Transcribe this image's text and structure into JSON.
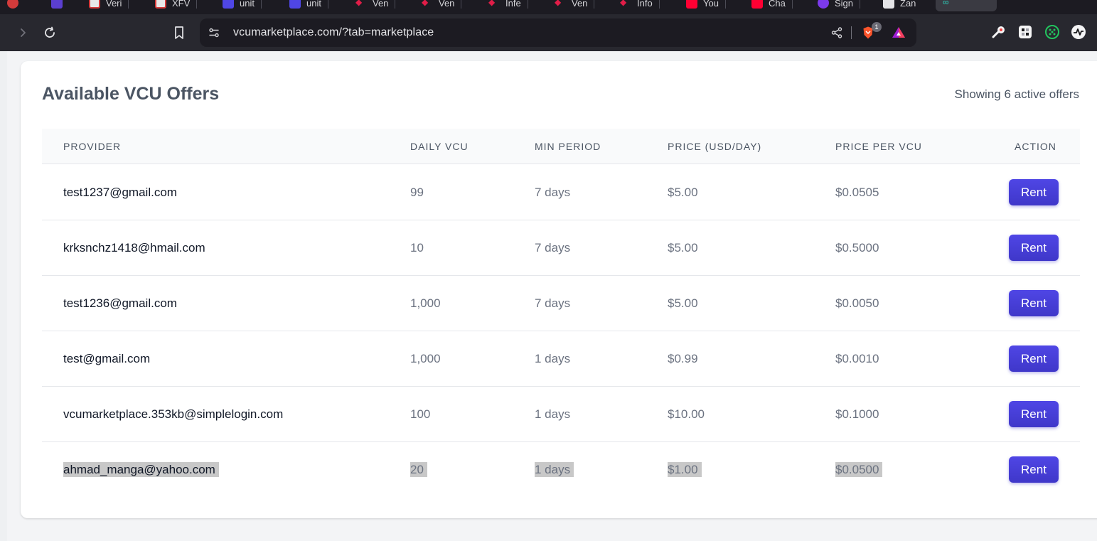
{
  "browser": {
    "tabs": [
      {
        "label": "Veri",
        "color": "#d63a3a"
      },
      {
        "label": "XFV",
        "color": "#d63a3a"
      },
      {
        "label": "unit",
        "color": "#4f46e5"
      },
      {
        "label": "unit",
        "color": "#4f46e5"
      },
      {
        "label": "Ven",
        "color": "#e11d48"
      },
      {
        "label": "Ven",
        "color": "#e11d48"
      },
      {
        "label": "Infe",
        "color": "#e11d48"
      },
      {
        "label": "Ven",
        "color": "#e11d48"
      },
      {
        "label": "Info",
        "color": "#e11d48"
      },
      {
        "label": "You",
        "color": "#ff0033"
      },
      {
        "label": "Cha",
        "color": "#ff0033"
      },
      {
        "label": "Sign",
        "color": "#7c3aed"
      },
      {
        "label": "Zan",
        "color": "#e4e4e7"
      }
    ],
    "url": "vcumarketplace.com/?tab=marketplace",
    "shield_badge_count": "1"
  },
  "page": {
    "title": "Available VCU Offers",
    "offer_count_text": "Showing 6 active offers"
  },
  "table": {
    "headers": {
      "provider": "PROVIDER",
      "daily_vcu": "DAILY VCU",
      "min_period": "MIN PERIOD",
      "price": "PRICE (USD/DAY)",
      "price_per_vcu": "PRICE PER VCU",
      "action": "ACTION"
    },
    "rows": [
      {
        "provider": "test1237@gmail.com",
        "daily_vcu": "99",
        "min_period": "7 days",
        "price": "$5.00",
        "price_per_vcu": "$0.0505",
        "action": "Rent"
      },
      {
        "provider": "krksnchz1418@hmail.com",
        "daily_vcu": "10",
        "min_period": "7 days",
        "price": "$5.00",
        "price_per_vcu": "$0.5000",
        "action": "Rent"
      },
      {
        "provider": "test1236@gmail.com",
        "daily_vcu": "1,000",
        "min_period": "7 days",
        "price": "$5.00",
        "price_per_vcu": "$0.0050",
        "action": "Rent"
      },
      {
        "provider": "test@gmail.com",
        "daily_vcu": "1,000",
        "min_period": "1 days",
        "price": "$0.99",
        "price_per_vcu": "$0.0010",
        "action": "Rent"
      },
      {
        "provider": "vcumarketplace.353kb@simplelogin.com",
        "daily_vcu": "100",
        "min_period": "1 days",
        "price": "$10.00",
        "price_per_vcu": "$0.1000",
        "action": "Rent"
      },
      {
        "provider": "ahmad_manga@yahoo.com",
        "daily_vcu": "20",
        "min_period": "1 days",
        "price": "$1.00",
        "price_per_vcu": "$0.0500",
        "action": "Rent"
      }
    ]
  },
  "colors": {
    "accent": "#4338ca",
    "selection": "#c8c8c8"
  }
}
